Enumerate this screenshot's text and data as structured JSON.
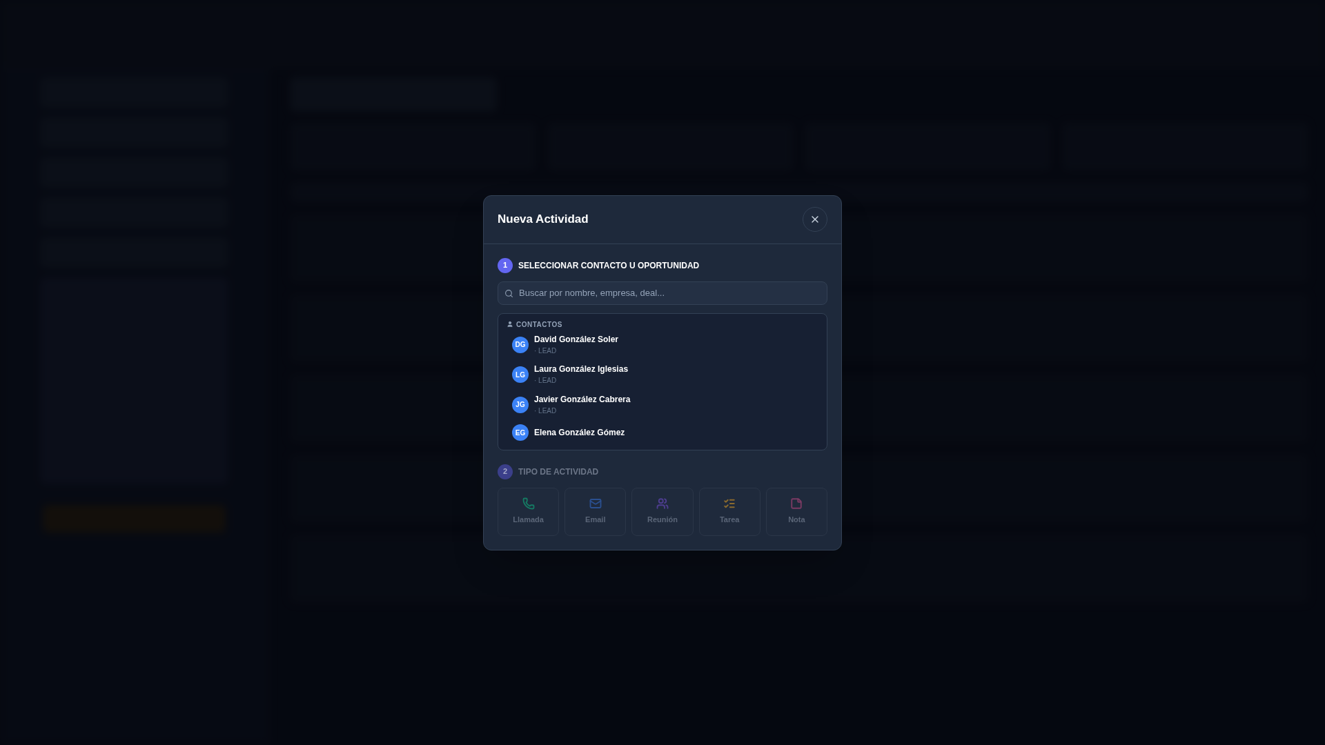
{
  "dialog": {
    "title": "Nueva Actividad",
    "steps": [
      {
        "number": "1",
        "label": "SELECCIONAR CONTACTO U OPORTUNIDAD",
        "disabled": false
      },
      {
        "number": "2",
        "label": "TIPO DE ACTIVIDAD",
        "disabled": true
      }
    ],
    "search": {
      "placeholder": "Buscar por nombre, empresa, deal..."
    },
    "contacts_heading": "CONTACTOS",
    "contacts": [
      {
        "initials": "DG",
        "name": "David González Soler",
        "tag": "· LEAD"
      },
      {
        "initials": "LG",
        "name": "Laura González Iglesias",
        "tag": "· LEAD"
      },
      {
        "initials": "JG",
        "name": "Javier González Cabrera",
        "tag": "· LEAD"
      },
      {
        "initials": "EG",
        "name": "Elena González Gómez"
      }
    ],
    "activity_types": [
      {
        "kind": "call",
        "label": "Llamada",
        "color": "#157a63",
        "disabled": true
      },
      {
        "kind": "email",
        "label": "Email",
        "color": "#2a4f8f",
        "disabled": true
      },
      {
        "kind": "meeting",
        "label": "Reunión",
        "color": "#4d3d8f",
        "disabled": true
      },
      {
        "kind": "task",
        "label": "Tarea",
        "color": "#8a6a2e",
        "disabled": true
      },
      {
        "kind": "note",
        "label": "Nota",
        "color": "#7a3a63",
        "disabled": true
      }
    ]
  }
}
